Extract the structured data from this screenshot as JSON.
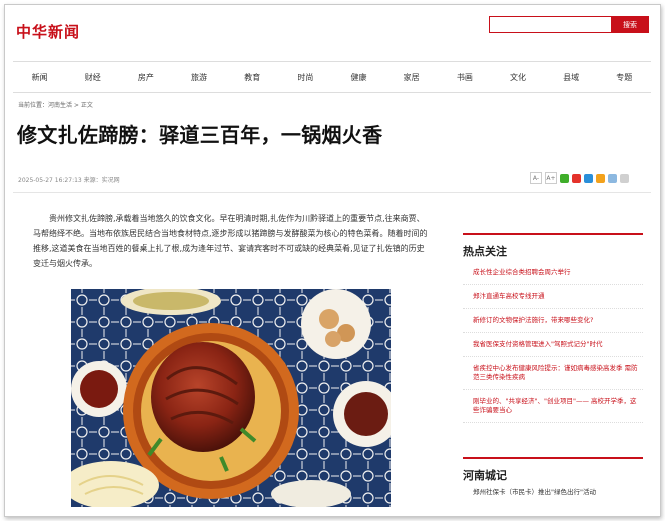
{
  "site": {
    "logo": "中华新闻"
  },
  "search": {
    "placeholder": "",
    "button": "搜索"
  },
  "nav": [
    "新闻",
    "财经",
    "房产",
    "旅游",
    "教育",
    "时尚",
    "健康",
    "家居",
    "书画",
    "文化",
    "县域",
    "专题"
  ],
  "breadcrumb": "当前位置：河南生活 > 正文",
  "article": {
    "title": "修文扎佐蹄膀：驿道三百年，一锅烟火香",
    "meta": "2025-05-27 16:27:13 来源：实况网",
    "tools": [
      "A-",
      "A+"
    ],
    "paragraph": "贵州修文扎佐蹄膀,承载着当地悠久的饮食文化。早在明清时期,扎佐作为川黔驿道上的重要节点,往来商贾、马帮络绎不绝。当地布依族居民结合当地食材特点,逐步形成以猪蹄膀与发酵酸菜为核心的特色菜肴。随着时间的推移,这道美食在当地百姓的餐桌上扎了根,成为逢年过节、宴请宾客时不可或缺的经典菜肴,见证了扎佐镇的历史变迁与烟火传承。"
  },
  "sidebar": {
    "title": "热点关注",
    "items": [
      "成长性企业综合类招聘会周六举行",
      "郑汴直通车高校专线开通",
      "新修订的文物保护法施行，带来哪些变化?",
      "我省医保支付资格管理进入\"驾照式记分\"时代",
      "省疾控中心发布健康风险提示：谨如病毒感染高发季 需防范三类传染性疾病",
      "刚毕业的、\"共享经济\"、\"创业项目\"—— 高校开学季，这些诈骗要当心"
    ],
    "title2": "河南城记",
    "items2": [
      "郑州社保卡（市民卡）推出\"绿色出行\"活动"
    ]
  },
  "colors": {
    "brand": "#c8101a"
  }
}
